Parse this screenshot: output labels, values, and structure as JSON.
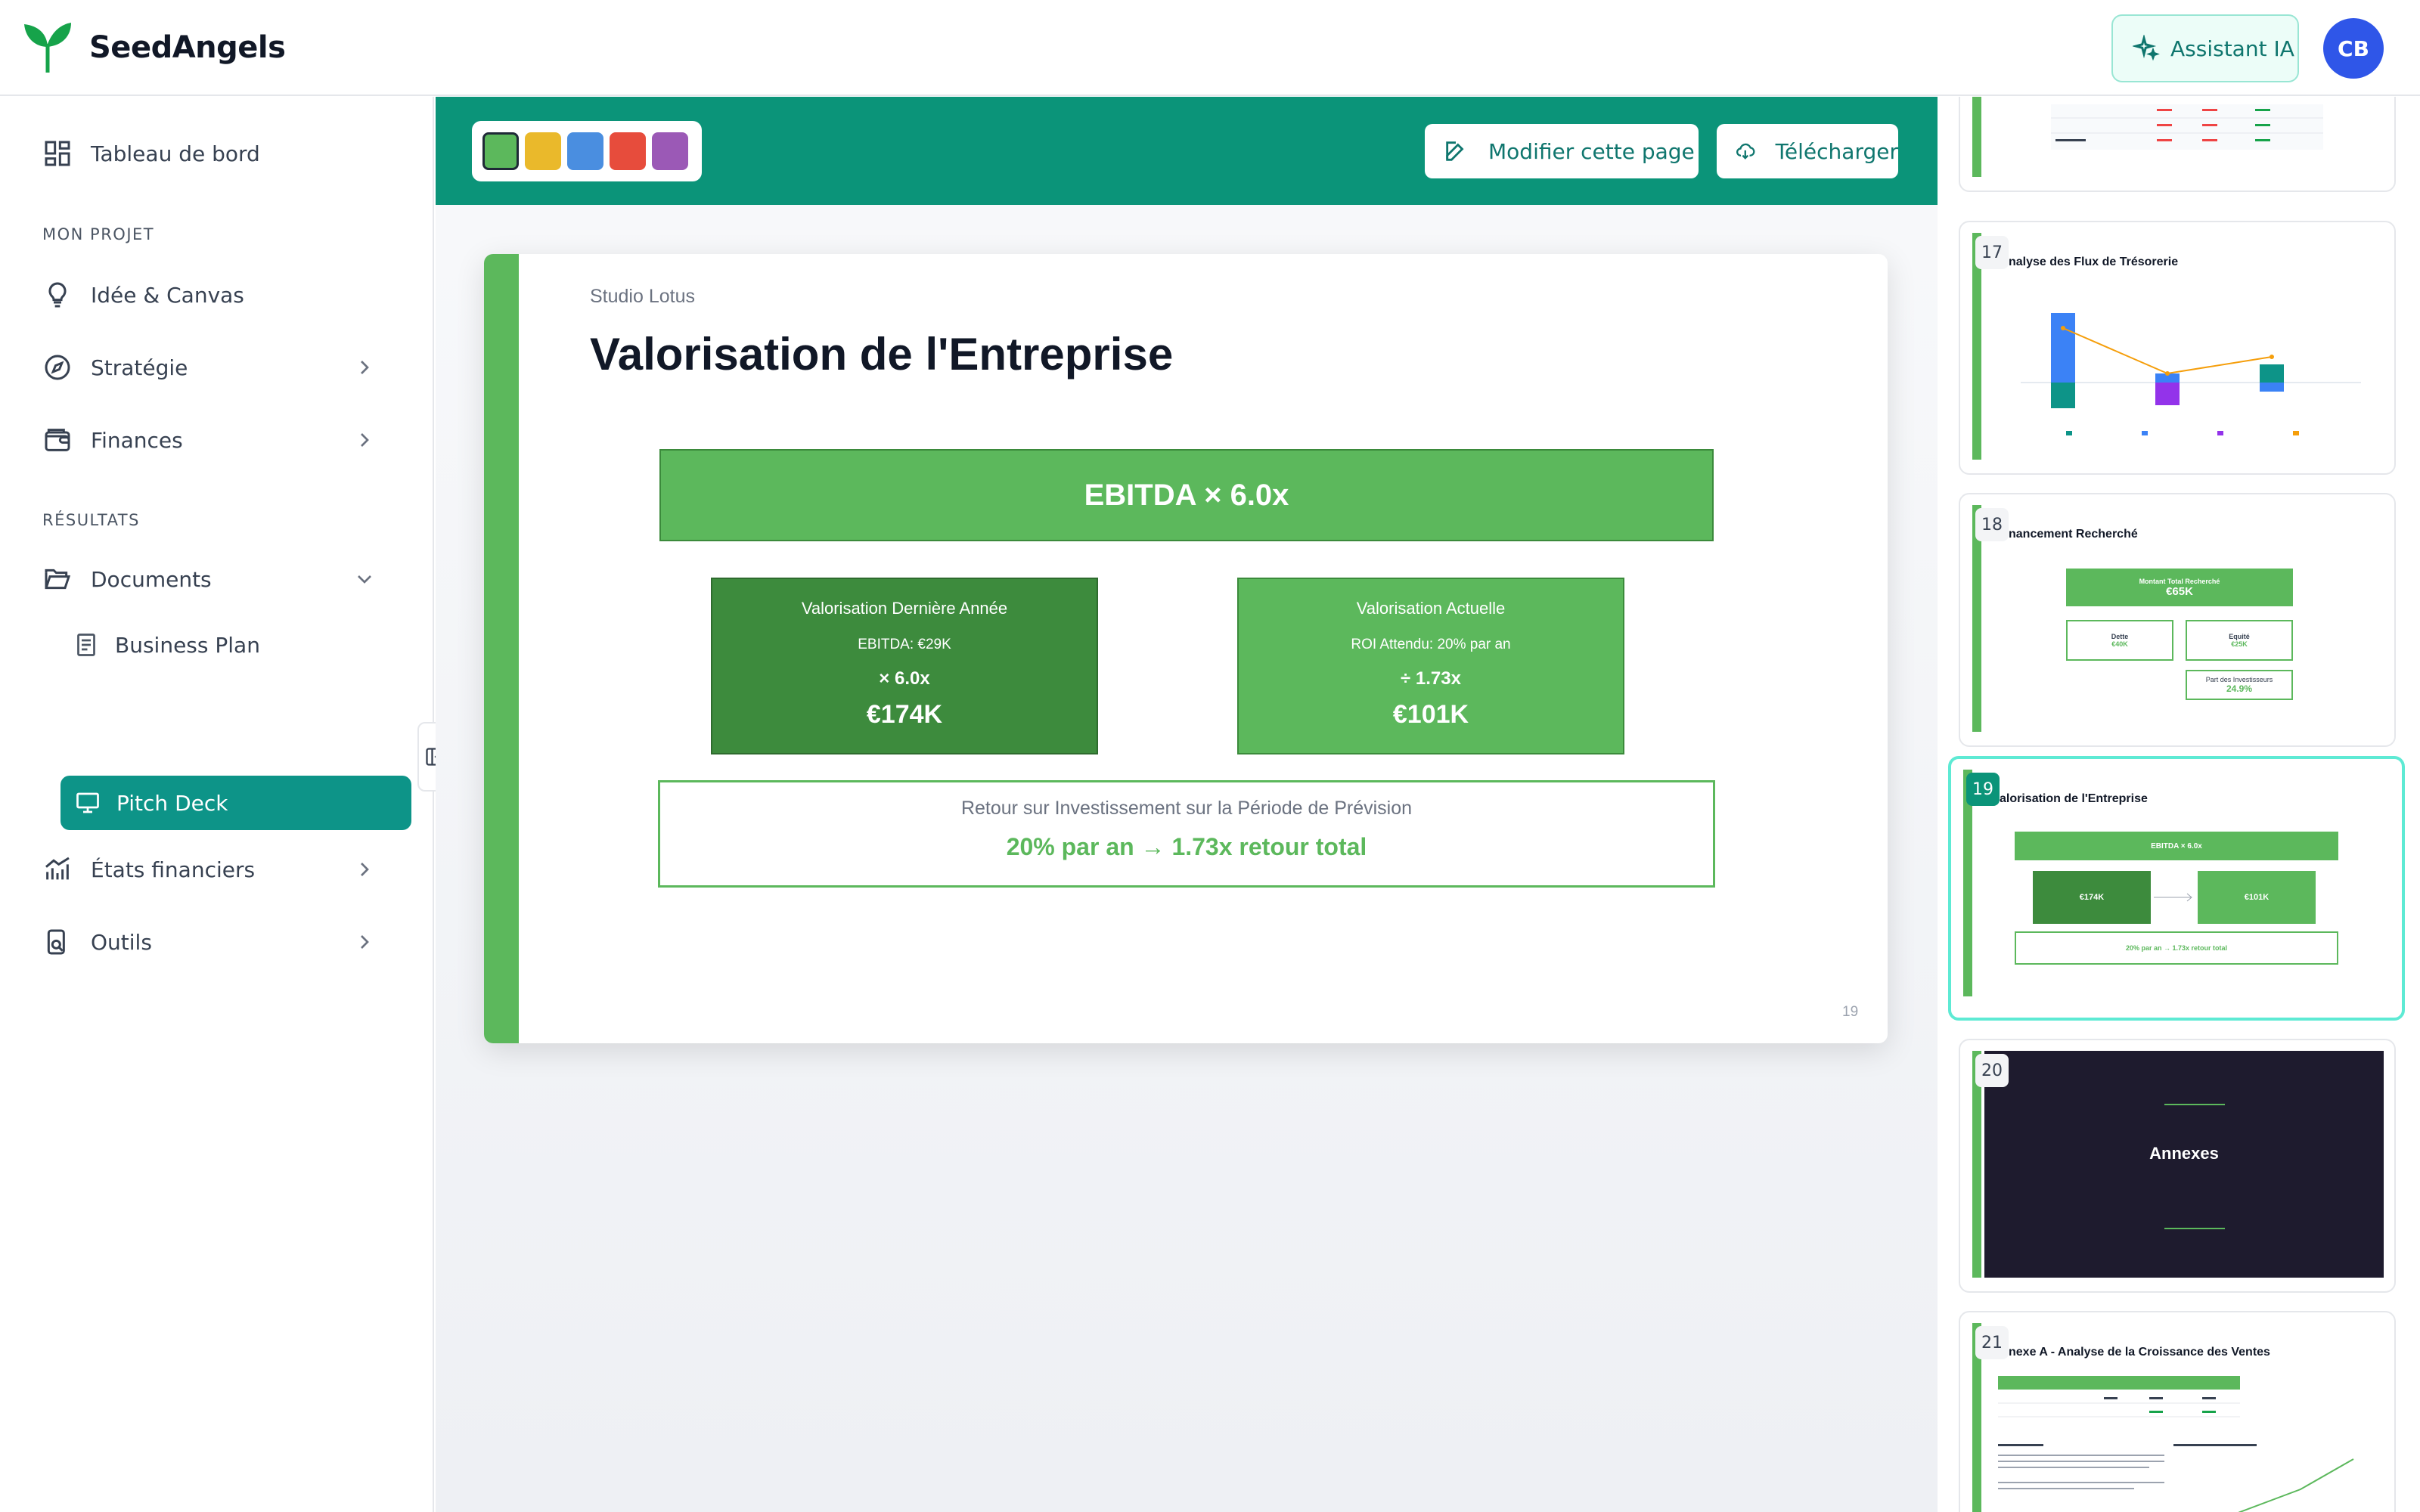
{
  "app": {
    "name": "SeedAngels"
  },
  "header": {
    "assistant_label": "Assistant IA",
    "avatar_initials": "CB"
  },
  "sidebar": {
    "dashboard": "Tableau de bord",
    "section_project": "MON PROJET",
    "idea": "Idée & Canvas",
    "strategy": "Stratégie",
    "finances": "Finances",
    "section_results": "RÉSULTATS",
    "documents": "Documents",
    "business_plan": "Business Plan",
    "pitch_deck": "Pitch Deck",
    "financial_statements": "États financiers",
    "tools": "Outils"
  },
  "toolbar": {
    "swatches": [
      "#5cb85c",
      "#eab92b",
      "#4a8ee0",
      "#e74c3c",
      "#9b59b6"
    ],
    "edit_label": "Modifier cette page",
    "download_label": "Télécharger"
  },
  "slide": {
    "company": "Studio Lotus",
    "title": "Valorisation de l'Entreprise",
    "formula": "EBITDA × 6.0x",
    "last_year": {
      "title": "Valorisation Dernière Année",
      "sub": "EBITDA: €29K",
      "mult": "× 6.0x",
      "value": "€174K",
      "color": "#3d8b3d"
    },
    "current": {
      "title": "Valorisation Actuelle",
      "sub": "ROI Attendu: 20% par an",
      "mult": "÷ 1.73x",
      "value": "€101K",
      "color": "#5cb85c"
    },
    "roi_title": "Retour sur Investissement sur la Période de Prévision",
    "roi_value": "20% par an → 1.73x retour total",
    "page_number": "19"
  },
  "thumbnails": [
    {
      "num": "17",
      "title": "nalyse des Flux de Trésorerie"
    },
    {
      "num": "18",
      "title": "nancement Recherché",
      "total_label": "Montant Total Recherché",
      "total_value": "€65K",
      "debt_label": "Dette",
      "debt_value": "€40K",
      "equity_label": "Equité",
      "equity_value": "€25K",
      "share_label": "Part des Investisseurs",
      "share_value": "24.9%"
    },
    {
      "num": "19",
      "title": "alorisation de l'Entreprise",
      "formula": "EBITDA × 6.0x",
      "last_value": "€174K",
      "current_value": "€101K",
      "roi": "20% par an → 1.73x retour total"
    },
    {
      "num": "20",
      "title": "Annexes"
    },
    {
      "num": "21",
      "title": "nexe A - Analyse de la Croissance des Ventes"
    }
  ]
}
